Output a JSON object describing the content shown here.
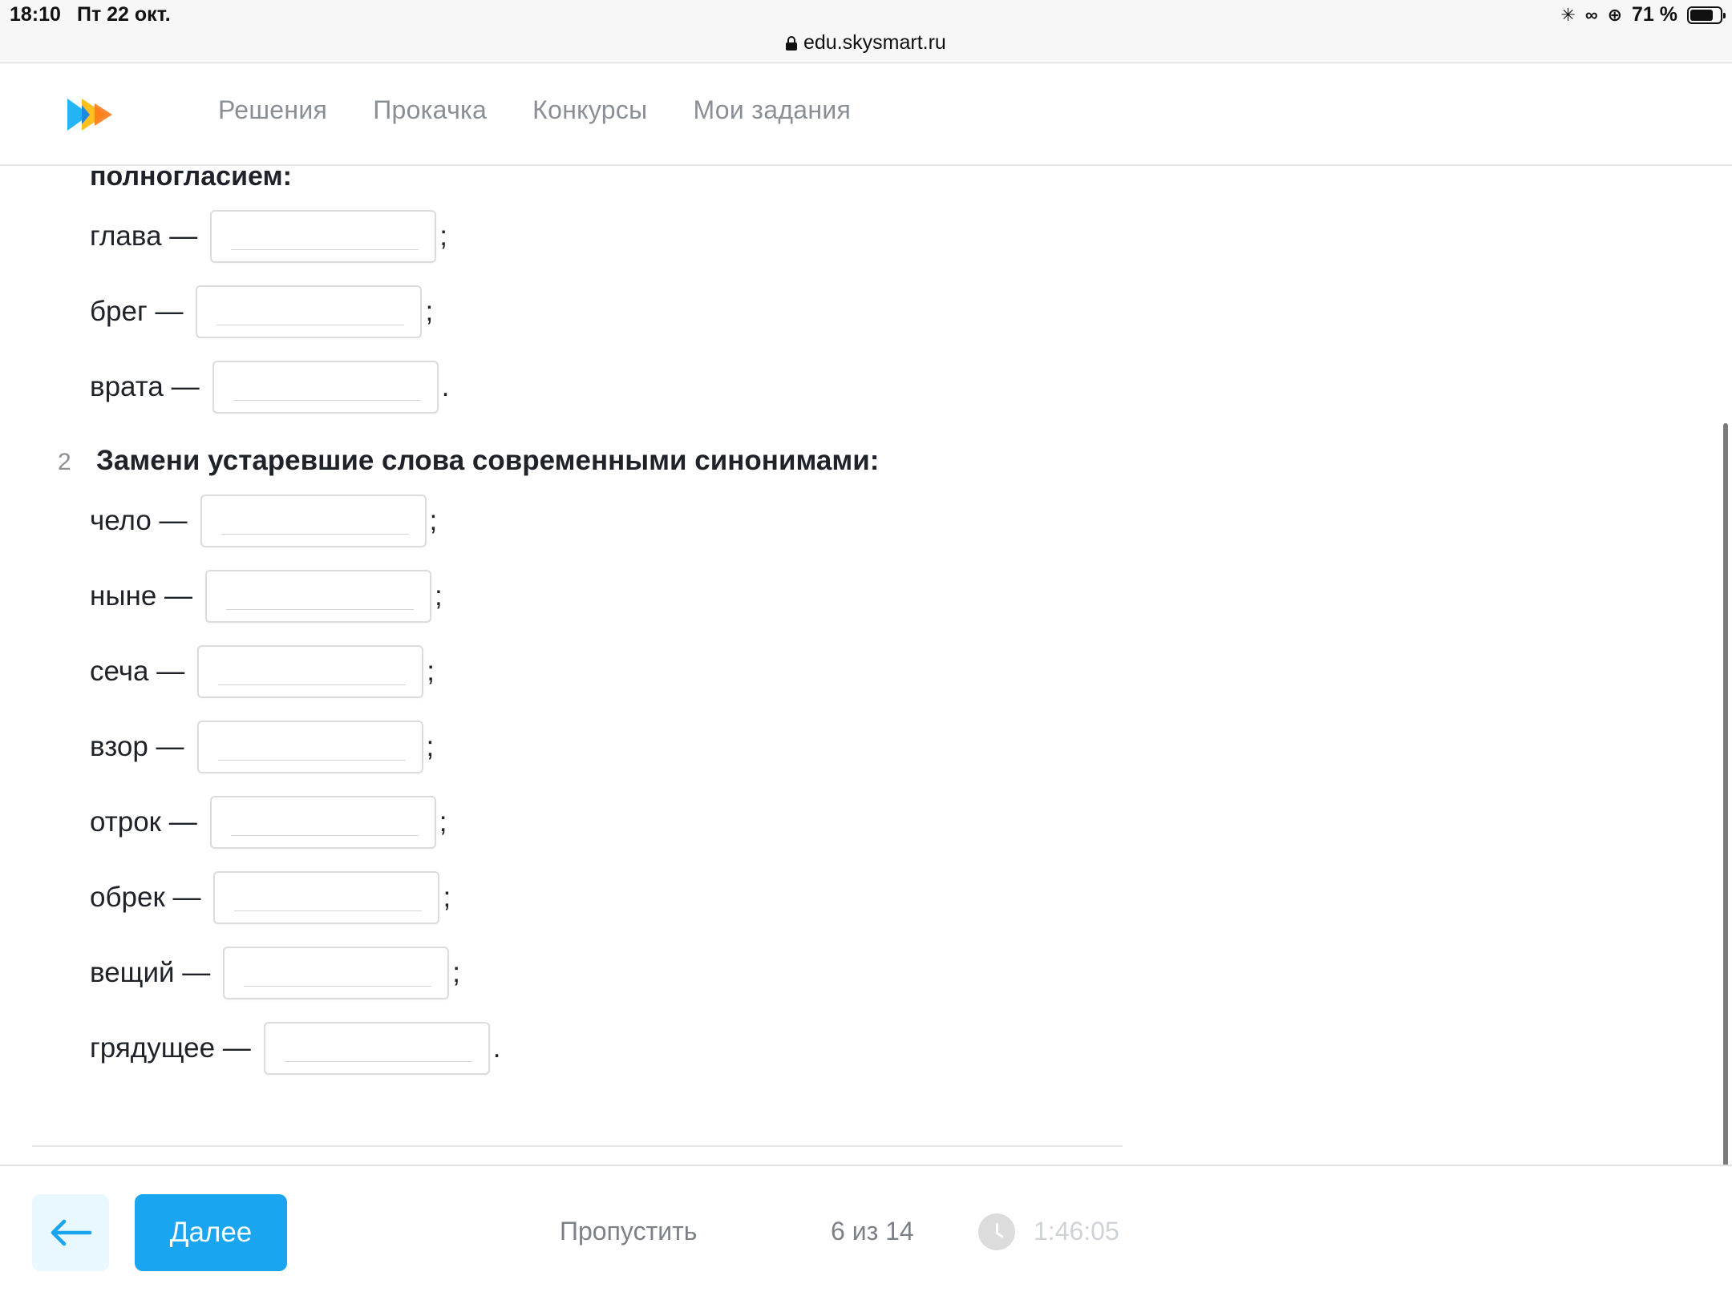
{
  "status_bar": {
    "time": "18:10",
    "date": "Пт 22 окт.",
    "url": "edu.skysmart.ru",
    "battery": "71 %",
    "battery_level": 0.71
  },
  "header": {
    "nav": [
      "Решения",
      "Прокачка",
      "Конкурсы",
      "Мои задания"
    ]
  },
  "task1": {
    "title_tail": "полногласием:",
    "items": [
      {
        "word": "глава —",
        "value": "",
        "punct": ";"
      },
      {
        "word": "брег —",
        "value": "",
        "punct": ";"
      },
      {
        "word": "врата —",
        "value": "",
        "punct": "."
      }
    ]
  },
  "task2": {
    "number": "2",
    "title": "Замени устаревшие слова современными синонимами:",
    "items": [
      {
        "word": "чело —",
        "value": "",
        "punct": ";"
      },
      {
        "word": "ныне —",
        "value": "",
        "punct": ";"
      },
      {
        "word": "сеча —",
        "value": "",
        "punct": ";"
      },
      {
        "word": "взор —",
        "value": "",
        "punct": ";"
      },
      {
        "word": "отрок —",
        "value": "",
        "punct": ";"
      },
      {
        "word": "обрек —",
        "value": "",
        "punct": ";"
      },
      {
        "word": "вещий —",
        "value": "",
        "punct": ";"
      },
      {
        "word": "грядущее —",
        "value": "",
        "punct": "."
      }
    ]
  },
  "footer": {
    "next_label": "Далее",
    "skip_label": "Пропустить",
    "progress": "6 из 14",
    "timer": "1:46:05"
  },
  "colors": {
    "accent": "#1aa5f0",
    "back_button_bg": "#e9f8fe",
    "nav_text": "#8a8f96"
  },
  "icons": [
    "lock-icon",
    "sync-icon",
    "link-icon",
    "rotation-lock-icon",
    "battery-icon",
    "logo-icon",
    "back-arrow-icon",
    "clock-icon"
  ]
}
